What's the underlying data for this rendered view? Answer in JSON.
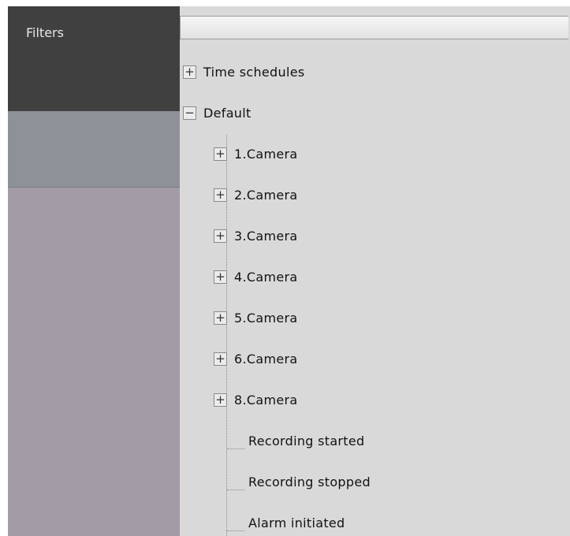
{
  "filters_panel": {
    "title": "Filters"
  },
  "search": {
    "value": "",
    "placeholder": ""
  },
  "tree": {
    "time_schedules": {
      "label": "Time schedules",
      "toggle": "+"
    },
    "default": {
      "label": "Default",
      "toggle": "−"
    },
    "cameras": [
      {
        "label": "1.Camera",
        "toggle": "+"
      },
      {
        "label": "2.Camera",
        "toggle": "+"
      },
      {
        "label": "3.Camera",
        "toggle": "+"
      },
      {
        "label": "4.Camera",
        "toggle": "+"
      },
      {
        "label": "5.Camera",
        "toggle": "+"
      },
      {
        "label": "6.Camera",
        "toggle": "+"
      },
      {
        "label": "8.Camera",
        "toggle": "+"
      }
    ],
    "events": [
      {
        "label": "Recording started"
      },
      {
        "label": "Recording stopped"
      },
      {
        "label": "Alarm initiated"
      }
    ]
  }
}
